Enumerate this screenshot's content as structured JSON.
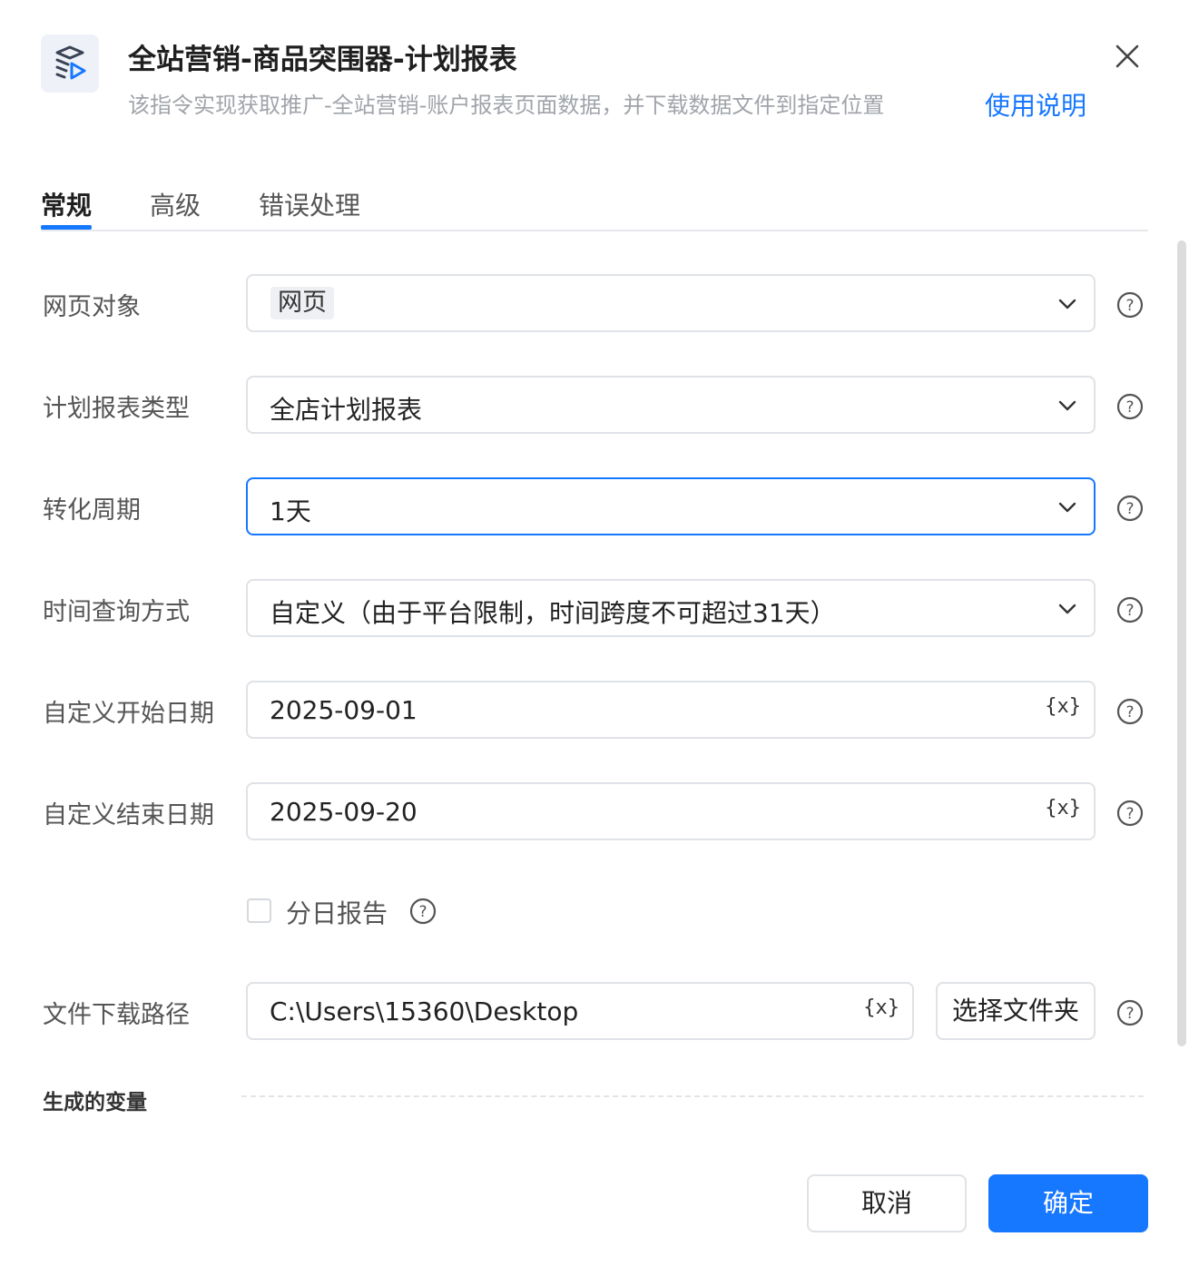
{
  "header": {
    "title": "全站营销-商品突围器-计划报表",
    "subtitle": "该指令实现获取推广-全站营销-账户报表页面数据，并下载数据文件到指定位置",
    "help_link": "使用说明"
  },
  "tabs": [
    {
      "label": "常规",
      "active": true
    },
    {
      "label": "高级",
      "active": false
    },
    {
      "label": "错误处理",
      "active": false
    }
  ],
  "form": {
    "web_object": {
      "label": "网页对象",
      "value": "网页"
    },
    "report_type": {
      "label": "计划报表类型",
      "value": "全店计划报表"
    },
    "conversion_period": {
      "label": "转化周期",
      "value": "1天"
    },
    "time_query_mode": {
      "label": "时间查询方式",
      "value": "自定义（由于平台限制，时间跨度不可超过31天）"
    },
    "start_date": {
      "label": "自定义开始日期",
      "value": "2025-09-01",
      "var_icon": "{x}"
    },
    "end_date": {
      "label": "自定义结束日期",
      "value": "2025-09-20",
      "var_icon": "{x}"
    },
    "daily_report": {
      "label": "分日报告",
      "checked": false
    },
    "download_path": {
      "label": "文件下载路径",
      "value": "C:\\Users\\15360\\Desktop",
      "var_icon": "{x}",
      "button_label": "选择文件夹"
    }
  },
  "variables_section": {
    "title": "生成的变量"
  },
  "footer": {
    "cancel_label": "取消",
    "ok_label": "确定"
  },
  "colors": {
    "accent": "#1677ff",
    "muted_text": "#a0a4aa",
    "border": "#dfe2e6"
  }
}
